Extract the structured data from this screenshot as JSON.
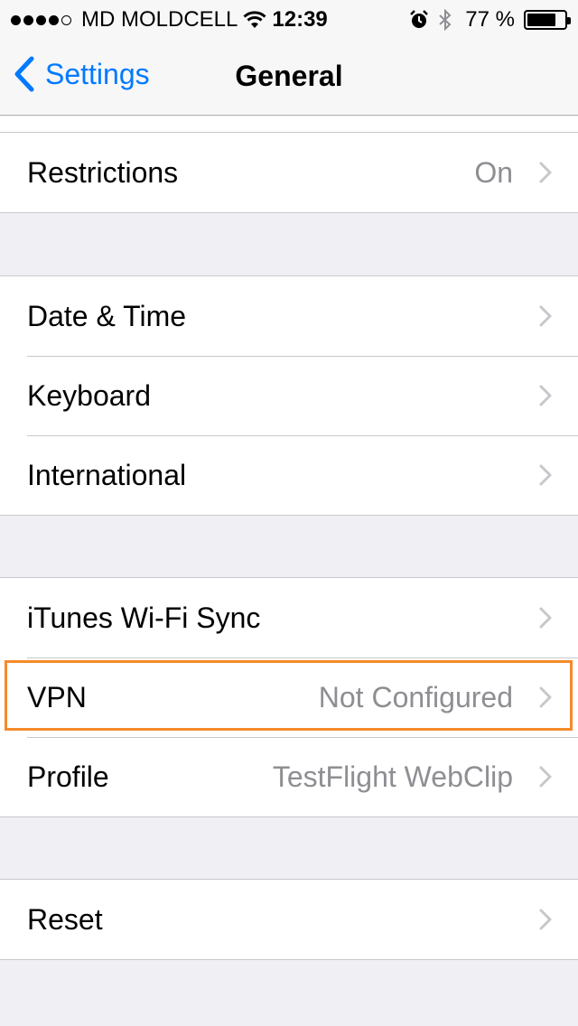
{
  "status_bar": {
    "carrier": "MD MOLDCELL",
    "signal_bars_filled": 4,
    "signal_bars_total": 5,
    "time": "12:39",
    "battery_text": "77 %",
    "battery_level": 0.77
  },
  "nav": {
    "back_label": "Settings",
    "title": "General"
  },
  "sections": [
    {
      "rows": [
        {
          "label": "Restrictions",
          "detail": "On"
        }
      ]
    },
    {
      "rows": [
        {
          "label": "Date & Time",
          "detail": ""
        },
        {
          "label": "Keyboard",
          "detail": ""
        },
        {
          "label": "International",
          "detail": ""
        }
      ]
    },
    {
      "rows": [
        {
          "label": "iTunes Wi-Fi Sync",
          "detail": ""
        },
        {
          "label": "VPN",
          "detail": "Not Configured"
        },
        {
          "label": "Profile",
          "detail": "TestFlight WebClip"
        }
      ]
    },
    {
      "rows": [
        {
          "label": "Reset",
          "detail": ""
        }
      ]
    }
  ],
  "colors": {
    "accent": "#007aff",
    "highlight": "#f58a2a",
    "detail_text": "#8e8e93",
    "group_background": "#efeff4"
  }
}
